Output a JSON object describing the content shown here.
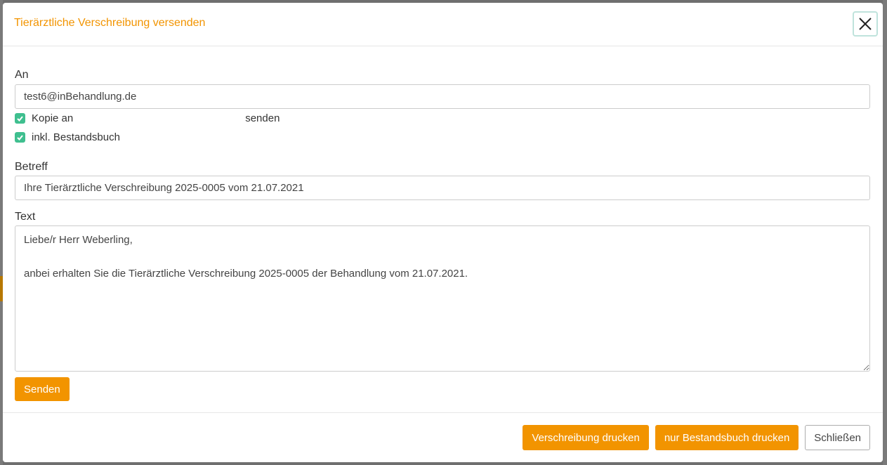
{
  "dialog": {
    "title": "Tierärztliche Verschreibung versenden"
  },
  "form": {
    "to_label": "An",
    "to_value": "test6@inBehandlung.de",
    "copy_label_prefix": "Kopie an",
    "copy_label_suffix": "senden",
    "copy_checked": true,
    "include_label": "inkl. Bestandsbuch",
    "include_checked": true,
    "subject_label": "Betreff",
    "subject_value": "Ihre Tierärztliche Verschreibung 2025-0005 vom 21.07.2021",
    "text_label": "Text",
    "text_value": "Liebe/r Herr Weberling,\n\nanbei erhalten Sie die Tierärztliche Verschreibung 2025-0005 der Behandlung vom 21.07.2021.",
    "send_label": "Senden"
  },
  "footer": {
    "print_prescription_label": "Verschreibung drucken",
    "print_book_label": "nur Bestandsbuch drucken",
    "close_label": "Schließen"
  },
  "colors": {
    "accent": "#f29400",
    "check": "#3fbf8f"
  }
}
